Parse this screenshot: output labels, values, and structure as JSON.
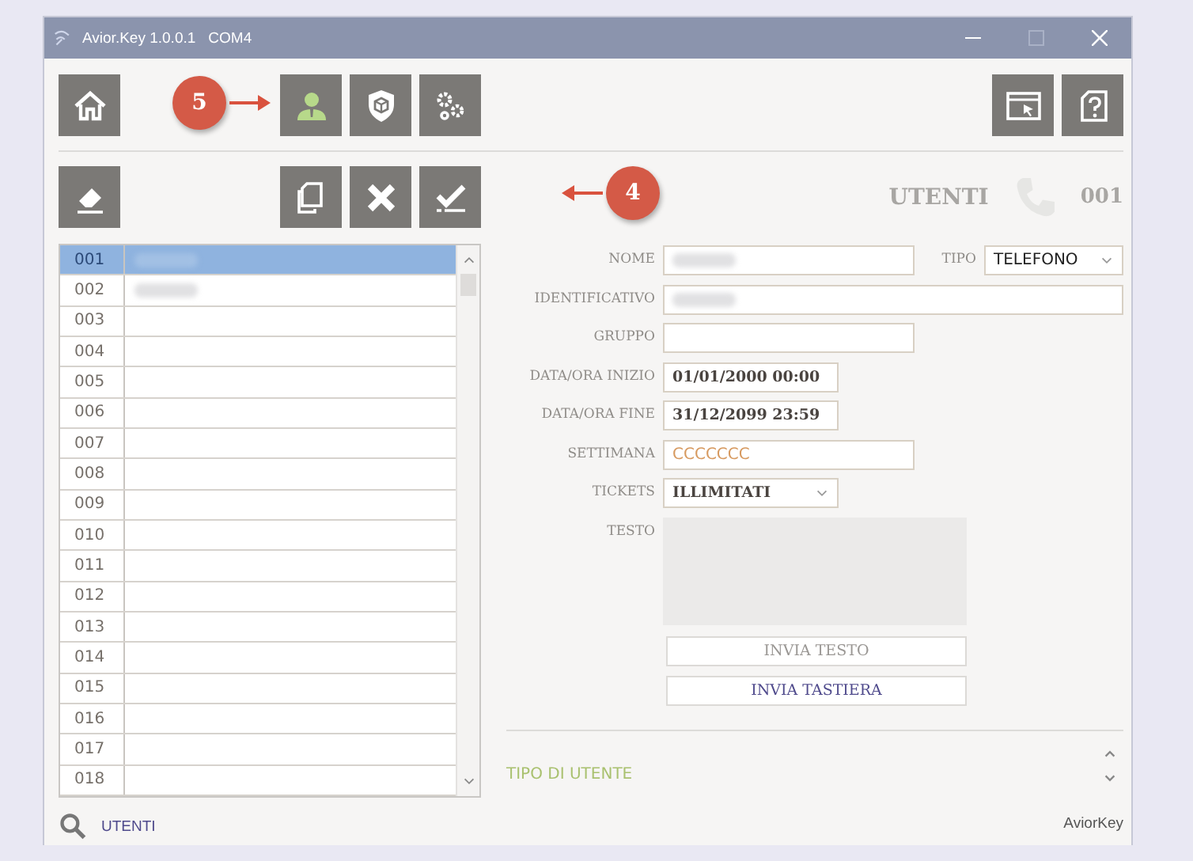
{
  "window": {
    "title": "Avior.Key 1.0.0.1",
    "port": "COM4"
  },
  "toolbar_top": {
    "left": [
      {
        "kind": "home",
        "selected": false
      }
    ],
    "middle": [
      {
        "kind": "user",
        "selected": true
      },
      {
        "kind": "cube",
        "selected": false
      },
      {
        "kind": "gears",
        "selected": false
      }
    ],
    "right": [
      {
        "kind": "window",
        "selected": false
      },
      {
        "kind": "help",
        "selected": false
      }
    ],
    "callout": "5"
  },
  "toolbar_bottom": {
    "left": [
      {
        "kind": "eraser"
      }
    ],
    "middle": [
      {
        "kind": "copy"
      },
      {
        "kind": "delete"
      },
      {
        "kind": "confirm"
      }
    ],
    "callout": "4"
  },
  "header": {
    "section": "UTENTI",
    "record": "001"
  },
  "list": {
    "rows": [
      {
        "number": "001",
        "selected": true,
        "redacted": true
      },
      {
        "number": "002",
        "selected": false,
        "redacted": true
      },
      {
        "number": "003",
        "selected": false,
        "redacted": false
      },
      {
        "number": "004",
        "selected": false,
        "redacted": false
      },
      {
        "number": "005",
        "selected": false,
        "redacted": false
      },
      {
        "number": "006",
        "selected": false,
        "redacted": false
      },
      {
        "number": "007",
        "selected": false,
        "redacted": false
      },
      {
        "number": "008",
        "selected": false,
        "redacted": false
      },
      {
        "number": "009",
        "selected": false,
        "redacted": false
      },
      {
        "number": "010",
        "selected": false,
        "redacted": false
      },
      {
        "number": "011",
        "selected": false,
        "redacted": false
      },
      {
        "number": "012",
        "selected": false,
        "redacted": false
      },
      {
        "number": "013",
        "selected": false,
        "redacted": false
      },
      {
        "number": "014",
        "selected": false,
        "redacted": false
      },
      {
        "number": "015",
        "selected": false,
        "redacted": false
      },
      {
        "number": "016",
        "selected": false,
        "redacted": false
      },
      {
        "number": "017",
        "selected": false,
        "redacted": false
      },
      {
        "number": "018",
        "selected": false,
        "redacted": false
      }
    ]
  },
  "form": {
    "fields": [
      {
        "label": "NOME",
        "kind": "text",
        "redacted": true,
        "side": {
          "label": "TIPO",
          "value": "TELEFONO"
        }
      },
      {
        "label": "IDENTIFICATIVO",
        "kind": "text",
        "redacted": true
      },
      {
        "label": "GRUPPO",
        "kind": "text",
        "redacted": false
      },
      {
        "label": "DATA/ORA INIZIO",
        "kind": "text",
        "value": "01/01/2000   00:00"
      },
      {
        "label": "DATA/ORA FINE",
        "kind": "text",
        "value": "31/12/2099   23:59"
      },
      {
        "label": "SETTIMANA",
        "kind": "text",
        "value": "CCCCCCC",
        "highlight": true
      },
      {
        "label": "TICKETS",
        "kind": "select",
        "value": "ILLIMITATI"
      },
      {
        "label": "TESTO",
        "kind": "textarea"
      }
    ],
    "buttons": [
      {
        "label": "INVIA TESTO",
        "disabled": true
      },
      {
        "label": "INVIA TASTIERA",
        "disabled": false
      }
    ]
  },
  "info": {
    "title": "TIPO DI UTENTE"
  },
  "footer": {
    "search_label": "UTENTI",
    "brand": "AviorKey"
  }
}
